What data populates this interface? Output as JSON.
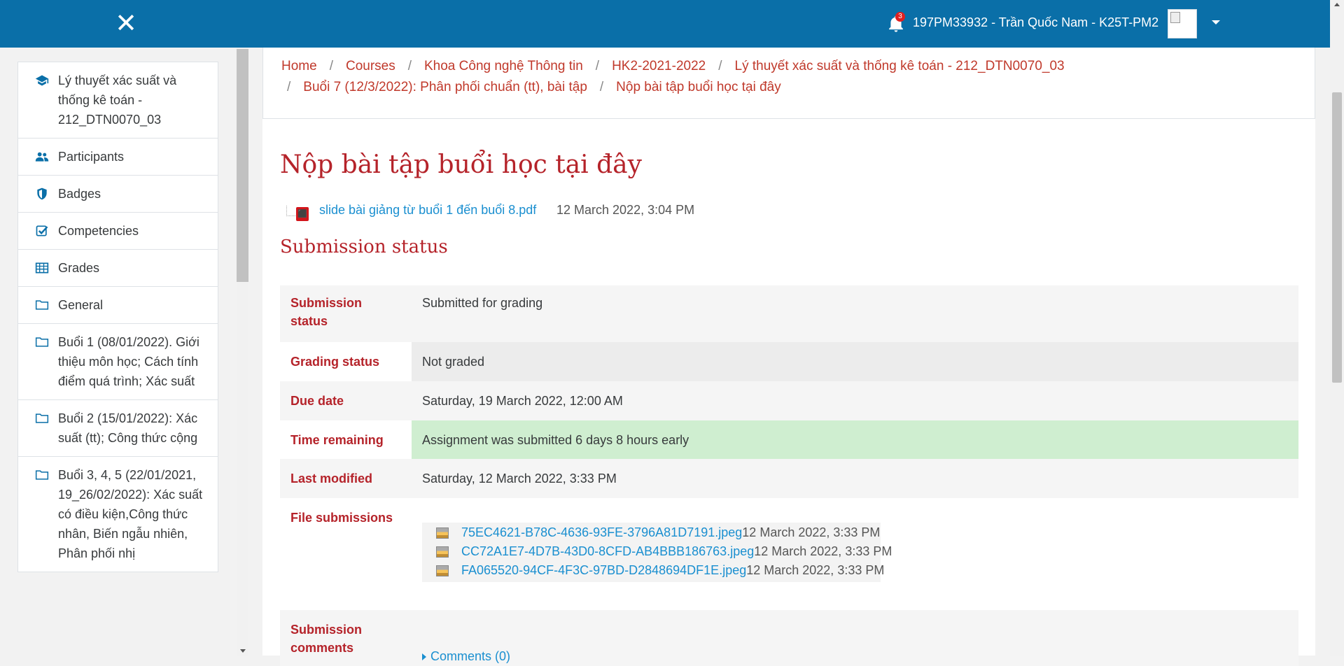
{
  "header": {
    "notification_count": "3",
    "user_name": "197PM33932 - Trần Quốc Nam - K25T-PM2"
  },
  "drawer": {
    "items": [
      {
        "label": "Lý thuyết xác suất và thống kê toán - 212_DTN0070_03",
        "icon": "graduation-cap-icon"
      },
      {
        "label": "Participants",
        "icon": "users-icon"
      },
      {
        "label": "Badges",
        "icon": "shield-icon"
      },
      {
        "label": "Competencies",
        "icon": "checkbox-icon"
      },
      {
        "label": "Grades",
        "icon": "table-icon"
      },
      {
        "label": "General",
        "icon": "folder-icon"
      },
      {
        "label": "Buổi 1 (08/01/2022). Giới thiệu môn học; Cách tính điểm quá trình; Xác suất",
        "icon": "folder-icon"
      },
      {
        "label": "Buổi 2 (15/01/2022): Xác suất (tt); Công thức cộng",
        "icon": "folder-icon"
      },
      {
        "label": "Buổi 3, 4, 5 (22/01/2021, 19_26/02/2022): Xác suất có điều kiện,Công thức nhân, Biến ngẫu nhiên, Phân phối nhị",
        "icon": "folder-icon"
      }
    ]
  },
  "breadcrumb": [
    "Home",
    "Courses",
    "Khoa Công nghệ Thông tin",
    "HK2-2021-2022",
    "Lý thuyết xác suất và thống kê toán - 212_DTN0070_03",
    "Buổi 7 (12/3/2022): Phân phối chuẩn (tt), bài tập",
    "Nộp bài tập buổi học tại đây"
  ],
  "page": {
    "title": "Nộp bài tập buổi học tại đây",
    "attachment_name": "slide bài giảng từ buổi 1 đến buổi 8.pdf",
    "attachment_date": "12 March 2022, 3:04 PM",
    "section_heading": "Submission status"
  },
  "status": {
    "submission_status_label": "Submission status",
    "submission_status_value": "Submitted for grading",
    "grading_status_label": "Grading status",
    "grading_status_value": "Not graded",
    "due_date_label": "Due date",
    "due_date_value": "Saturday, 19 March 2022, 12:00 AM",
    "time_remaining_label": "Time remaining",
    "time_remaining_value": "Assignment was submitted 6 days 8 hours early",
    "last_modified_label": "Last modified",
    "last_modified_value": "Saturday, 12 March 2022, 3:33 PM",
    "file_submissions_label": "File submissions",
    "files": [
      {
        "name": "75EC4621-B78C-4636-93FE-3796A81D7191.jpeg",
        "date": "12 March 2022, 3:33 PM"
      },
      {
        "name": "CC72A1E7-4D7B-43D0-8CFD-AB4BBB186763.jpeg",
        "date": "12 March 2022, 3:33 PM"
      },
      {
        "name": "FA065520-94CF-4F3C-97BD-D2848694DF1E.jpeg",
        "date": "12 March 2022, 3:33 PM"
      }
    ],
    "submission_comments_label": "Submission comments",
    "comments_link": "Comments (0)"
  },
  "colors": {
    "header_bg": "#0a6fa8",
    "accent_red": "#b5232a",
    "link_blue": "#1a8fd0",
    "success_green": "#cfeed0"
  }
}
